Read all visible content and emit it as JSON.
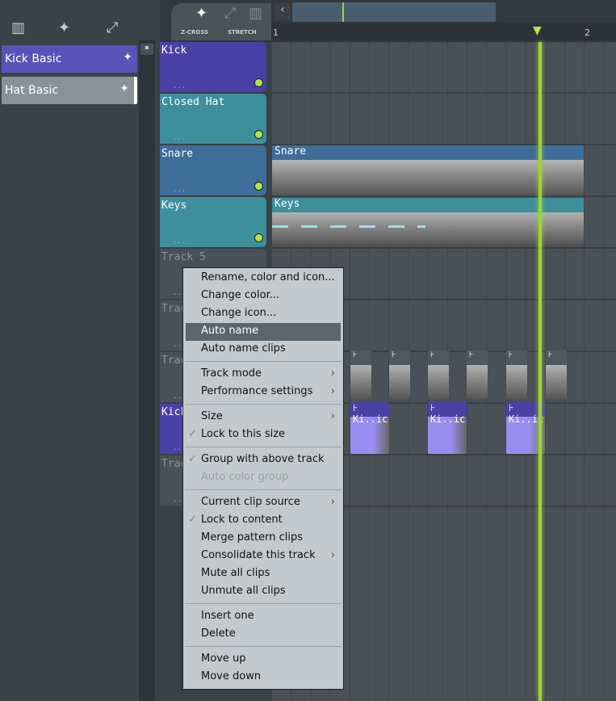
{
  "browser": {
    "toolbar_icons": [
      "piano-icon",
      "waveform-icon",
      "automation-icon"
    ],
    "channels": [
      {
        "label": "Kick Basic",
        "color": "#5a52b8"
      },
      {
        "label": "Hat Basic",
        "color": "#8a9199"
      }
    ]
  },
  "playlist": {
    "toggle_zcross": "Z-CROSS",
    "toggle_stretch": "STRETCH",
    "ruler": [
      "1",
      "2"
    ],
    "playhead_color": "#9ad43a",
    "tracks": [
      {
        "name": "Kick",
        "color": "#4b40a6"
      },
      {
        "name": "Closed Hat",
        "color": "#3d8f9c"
      },
      {
        "name": "Snare",
        "color": "#3e6d99"
      },
      {
        "name": "Keys",
        "color": "#3d8f9c"
      },
      {
        "name": "Track 5",
        "color": "#495056"
      },
      {
        "name": "Trac",
        "color": "#495056"
      },
      {
        "name": "Trac",
        "color": "#495056"
      },
      {
        "name": "Kick",
        "color": "#4b40a6"
      },
      {
        "name": "Trac",
        "color": "#495056"
      }
    ],
    "clips": {
      "snare": "Snare",
      "keys": "Keys",
      "kick": "Ki..ic"
    }
  },
  "menu": {
    "items": [
      {
        "label": "Rename, color and icon..."
      },
      {
        "label": "Change color..."
      },
      {
        "label": "Change icon..."
      },
      {
        "label": "Auto name",
        "highlighted": true
      },
      {
        "label": "Auto name clips"
      },
      {
        "sep": true
      },
      {
        "label": "Track mode",
        "submenu": true
      },
      {
        "label": "Performance settings",
        "submenu": true
      },
      {
        "sep": true
      },
      {
        "label": "Size",
        "submenu": true
      },
      {
        "label": "Lock to this size",
        "checked": true
      },
      {
        "sep": true
      },
      {
        "label": "Group with above track",
        "checked": true
      },
      {
        "label": "Auto color group",
        "disabled": true
      },
      {
        "sep": true
      },
      {
        "label": "Current clip source",
        "submenu": true
      },
      {
        "label": "Lock to content",
        "checked": true
      },
      {
        "label": "Merge pattern clips"
      },
      {
        "label": "Consolidate this track",
        "submenu": true
      },
      {
        "label": "Mute all clips"
      },
      {
        "label": "Unmute all clips"
      },
      {
        "sep": true
      },
      {
        "label": "Insert one"
      },
      {
        "label": "Delete"
      },
      {
        "sep": true
      },
      {
        "label": "Move up"
      },
      {
        "label": "Move down"
      }
    ]
  }
}
